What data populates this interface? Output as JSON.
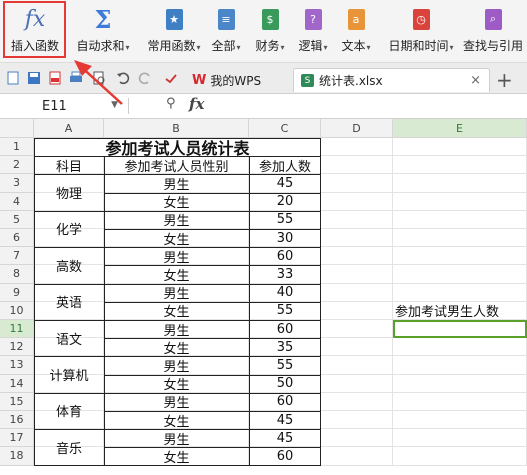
{
  "ribbon": {
    "items": [
      {
        "label": "插入函数",
        "icon": "fx-icon",
        "dropdown": false
      },
      {
        "label": "自动求和",
        "icon": "sigma-icon",
        "dropdown": true
      },
      {
        "label": "常用函数",
        "icon": "star-book-icon",
        "dropdown": true
      },
      {
        "label": "全部",
        "icon": "list-book-icon",
        "dropdown": true
      },
      {
        "label": "财务",
        "icon": "money-book-icon",
        "dropdown": true
      },
      {
        "label": "逻辑",
        "icon": "question-book-icon",
        "dropdown": true
      },
      {
        "label": "文本",
        "icon": "text-book-icon",
        "dropdown": true
      },
      {
        "label": "日期和时间",
        "icon": "clock-book-icon",
        "dropdown": true
      },
      {
        "label": "查找与引用",
        "icon": "search-book-icon",
        "dropdown": true
      }
    ],
    "glyphs": {
      "fx": "fx",
      "sigma": "Σ",
      "star": "★",
      "qmark": "?",
      "a": "a",
      "clock": "◷",
      "lens": "⌕",
      "list": "≡",
      "money": "$"
    }
  },
  "tabs": {
    "wps_logo": "W",
    "wps_label": "我的WPS",
    "file_icon": "S",
    "file_label": "统计表.xlsx",
    "close": "×",
    "add": "+"
  },
  "formula_bar": {
    "cell_ref": "E11",
    "zoom_icon": "⚲",
    "fx": "fx",
    "content": ""
  },
  "sheet": {
    "columns": [
      "A",
      "B",
      "C",
      "D",
      "E"
    ],
    "rows": [
      "1",
      "2",
      "3",
      "4",
      "5",
      "6",
      "7",
      "8",
      "9",
      "10",
      "11",
      "12",
      "13",
      "14",
      "15",
      "16",
      "17",
      "18"
    ],
    "selected_cell": "E11",
    "title": "参加考试人员统计表",
    "headers": [
      "科目",
      "参加考试人员性别",
      "参加人数"
    ],
    "subjects": [
      "物理",
      "化学",
      "高数",
      "英语",
      "语文",
      "计算机",
      "体育",
      "音乐"
    ],
    "genders": [
      "男生",
      "女生",
      "男生",
      "女生",
      "男生",
      "女生",
      "男生",
      "女生",
      "男生",
      "女生",
      "男生",
      "女生",
      "男生",
      "女生",
      "男生",
      "女生"
    ],
    "counts": [
      "45",
      "20",
      "55",
      "30",
      "60",
      "33",
      "40",
      "55",
      "60",
      "35",
      "55",
      "50",
      "60",
      "45",
      "45",
      "60"
    ],
    "e10_label": "参加考试男生人数"
  },
  "colors": {
    "highlight_box": "#e53935",
    "arrow": "#e53935",
    "selection": "#5aa02c"
  }
}
